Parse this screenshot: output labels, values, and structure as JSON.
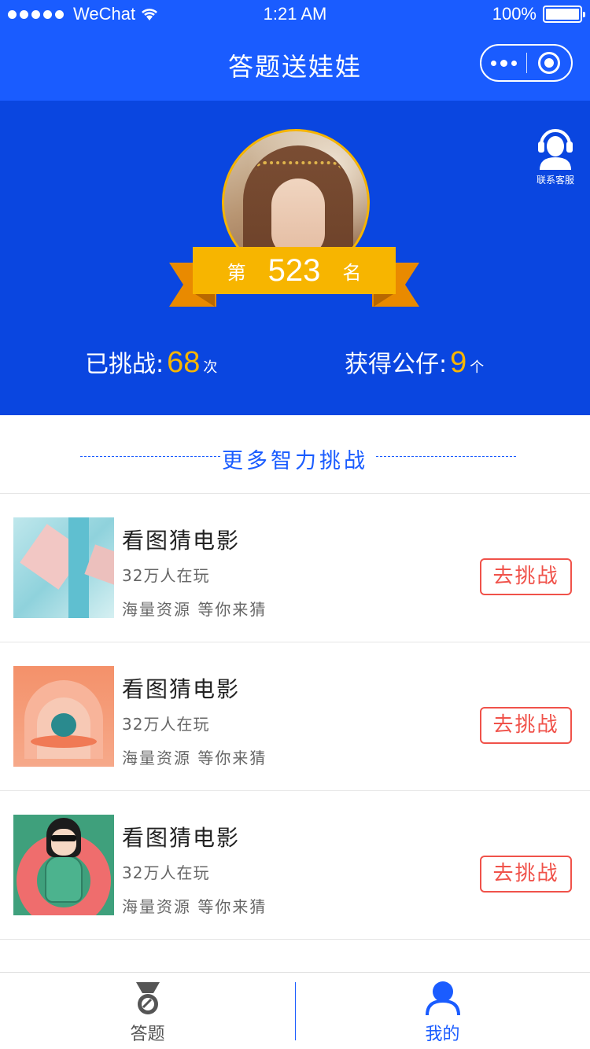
{
  "status_bar": {
    "carrier": "WeChat",
    "time": "1:21 AM",
    "battery": "100%",
    "battery_level": 1.0
  },
  "nav": {
    "title": "答题送娃娃",
    "more_icon": "more-dots-icon",
    "close_icon": "close-circle-icon"
  },
  "hero": {
    "service_label": "联系客服",
    "rank_prefix": "第",
    "rank": "523",
    "rank_suffix": "名",
    "challenged_label": "已挑战:",
    "challenged_count": "68",
    "challenged_unit": "次",
    "dolls_label": "获得公仔:",
    "dolls_count": "9",
    "dolls_unit": "个"
  },
  "section": {
    "title": "更多智力挑战"
  },
  "games": [
    {
      "name": "看图猜电影",
      "players": "32万人在玩",
      "desc": "海量资源 等你来猜",
      "button": "去挑战"
    },
    {
      "name": "看图猜电影",
      "players": "32万人在玩",
      "desc": "海量资源 等你来猜",
      "button": "去挑战"
    },
    {
      "name": "看图猜电影",
      "players": "32万人在玩",
      "desc": "海量资源 等你来猜",
      "button": "去挑战"
    }
  ],
  "tabbar": {
    "tabs": [
      {
        "label": "答题",
        "icon": "medal-icon",
        "active": false
      },
      {
        "label": "我的",
        "icon": "user-icon",
        "active": true
      }
    ]
  },
  "colors": {
    "brand_blue": "#1a5cff",
    "hero_blue": "#0a46e0",
    "gold": "#f7b500",
    "button_red": "#f0524a"
  }
}
